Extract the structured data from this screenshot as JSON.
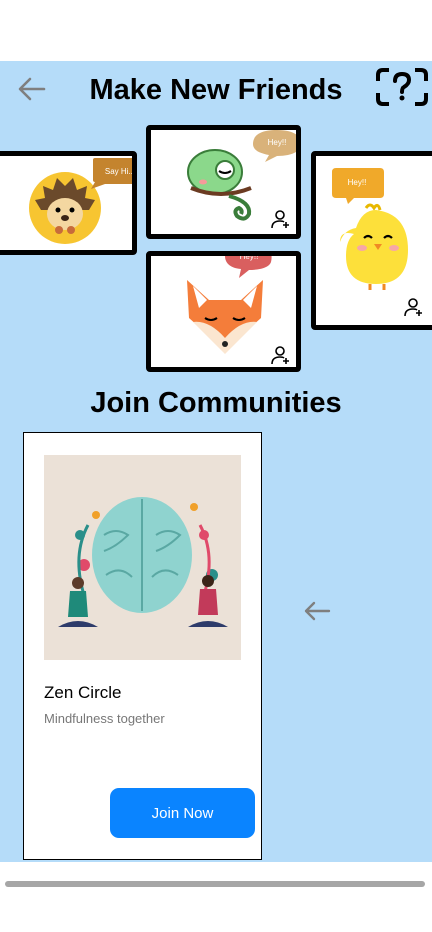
{
  "header": {
    "title": "Make New Friends",
    "back_icon": "arrow-left-icon",
    "help_icon": "question-frame-icon"
  },
  "friends": [
    {
      "animal": "hedgehog",
      "bubble": "Say Hi..."
    },
    {
      "animal": "chameleon",
      "bubble": "Hey!!"
    },
    {
      "animal": "fox",
      "bubble": "Hey!!"
    },
    {
      "animal": "chick",
      "bubble": "Hey!!"
    }
  ],
  "communities": {
    "title": "Join Communities",
    "card": {
      "name": "Zen Circle",
      "description": "Mindfulness together",
      "button": "Join Now"
    }
  },
  "colors": {
    "background": "#b5dcf9",
    "button": "#0a84ff",
    "bubble_brown": "#c4842e",
    "bubble_red": "#d95f5f",
    "bubble_yellow": "#f0a92a"
  }
}
